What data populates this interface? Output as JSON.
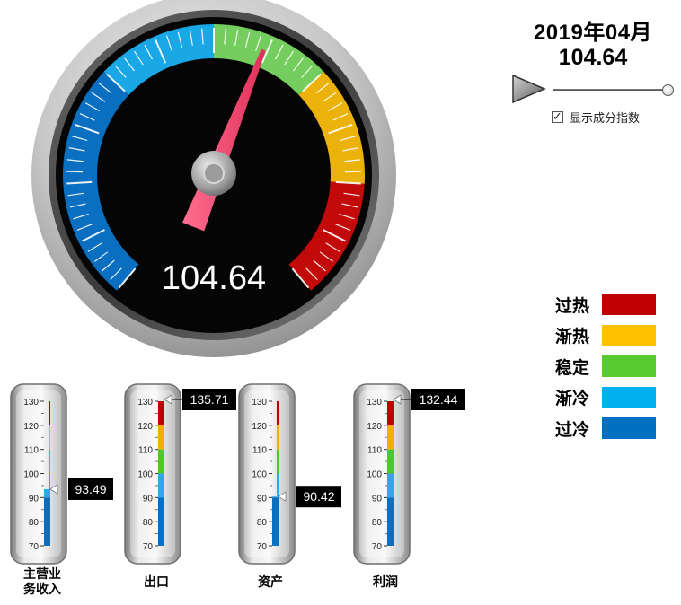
{
  "gauge": {
    "value": 104.64,
    "display_value": "104.64",
    "range": [
      70,
      130
    ],
    "bands": [
      {
        "from": 70,
        "to": 90,
        "color": "#0a6fc0"
      },
      {
        "from": 90,
        "to": 100,
        "color": "#1aa7e6"
      },
      {
        "from": 100,
        "to": 110,
        "color": "#74cd5e"
      },
      {
        "from": 110,
        "to": 120,
        "color": "#ecb20c"
      },
      {
        "from": 120,
        "to": 130,
        "color": "#c30a0a"
      }
    ]
  },
  "header": {
    "period": "2019年04月",
    "value": "104.64"
  },
  "controls": {
    "play_icon": "play-icon",
    "index_toggle_label": "显示成分指数",
    "index_toggle_checked": true,
    "timeline_position": 1.0
  },
  "legend": [
    {
      "label": "过热",
      "color": "#c00000"
    },
    {
      "label": "渐热",
      "color": "#ffc000"
    },
    {
      "label": "稳定",
      "color": "#56cc2c"
    },
    {
      "label": "渐冷",
      "color": "#00b0f0"
    },
    {
      "label": "过冷",
      "color": "#0070c0"
    }
  ],
  "thermometers": {
    "scale": [
      "130",
      "120",
      "110",
      "100",
      "90",
      "80",
      "70"
    ],
    "items": [
      {
        "label": "主营业务收入",
        "value": 93.49,
        "display": "93.49",
        "label_lines": [
          "主营业",
          "务收入"
        ]
      },
      {
        "label": "出口",
        "value": 135.71,
        "display": "135.71",
        "label_lines": [
          "出口"
        ]
      },
      {
        "label": "资产",
        "value": 90.42,
        "display": "90.42",
        "label_lines": [
          "资产"
        ]
      },
      {
        "label": "利润",
        "value": 132.44,
        "display": "132.44",
        "label_lines": [
          "利润"
        ]
      }
    ]
  }
}
